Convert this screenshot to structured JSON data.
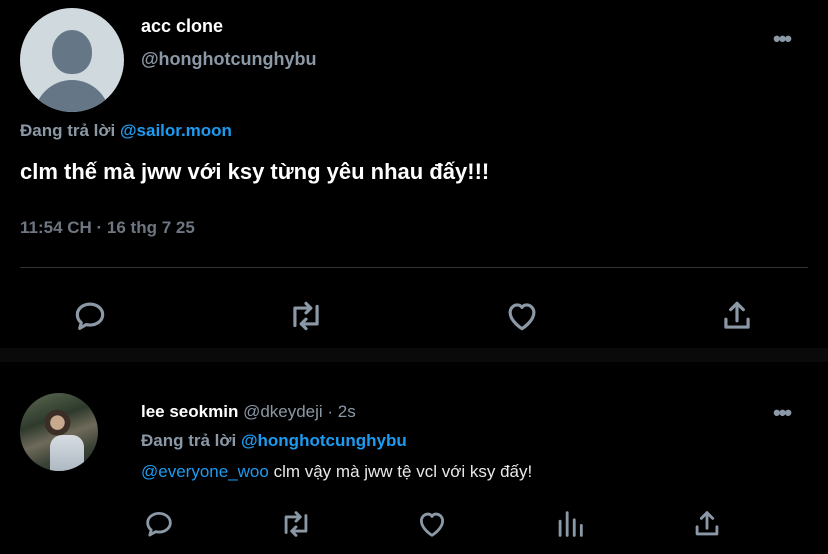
{
  "main_tweet": {
    "display_name": "acc clone",
    "handle": "@honghotcunghybu",
    "reply_prefix": "Đang trả lời",
    "reply_to": "@sailor.moon",
    "text": "clm thế mà jww với ksy từng yêu nhau đấy!!!",
    "timestamp": "11:54 CH · 16 thg 7 25",
    "more_label": "•••"
  },
  "reply_tweet": {
    "display_name": "lee seokmin",
    "handle_time": "@dkeydeji · 2s",
    "reply_prefix": "Đang trả lời",
    "reply_to": "@honghotcunghybu",
    "mention": "@everyone_woo",
    "text": " clm vậy mà jww tệ vcl với ksy đấy!",
    "more_label": "•••"
  },
  "icons": {
    "main_actions": [
      "reply-icon",
      "retweet-icon",
      "like-icon",
      "share-icon"
    ],
    "reply_actions": [
      "reply-icon",
      "retweet-icon",
      "like-icon",
      "analytics-icon",
      "share-icon"
    ]
  },
  "colors": {
    "background": "#000000",
    "link": "#1d9bf0",
    "secondary_text": "#8b98a5"
  }
}
